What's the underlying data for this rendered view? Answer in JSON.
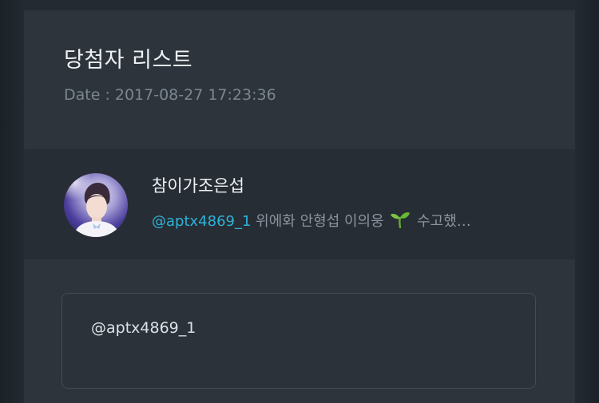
{
  "page": {
    "title": "당첨자 리스트",
    "date_label": "Date :",
    "date_value": "2017-08-27 17:23:36"
  },
  "winner": {
    "name": "참이가조은섭",
    "handle": "@aptx4869_1",
    "text_before_icon": "위에화 안형섭 이의웅",
    "icon": "sprout-emoji",
    "text_after_icon": "수고했…"
  },
  "answer": {
    "text": "@aptx4869_1"
  },
  "colors": {
    "background": "#232a31",
    "panel": "#2d343b",
    "winner_row": "#272d34",
    "handle": "#2cb3d8",
    "muted_text": "#7c8690",
    "primary_text": "#eef1f4"
  }
}
